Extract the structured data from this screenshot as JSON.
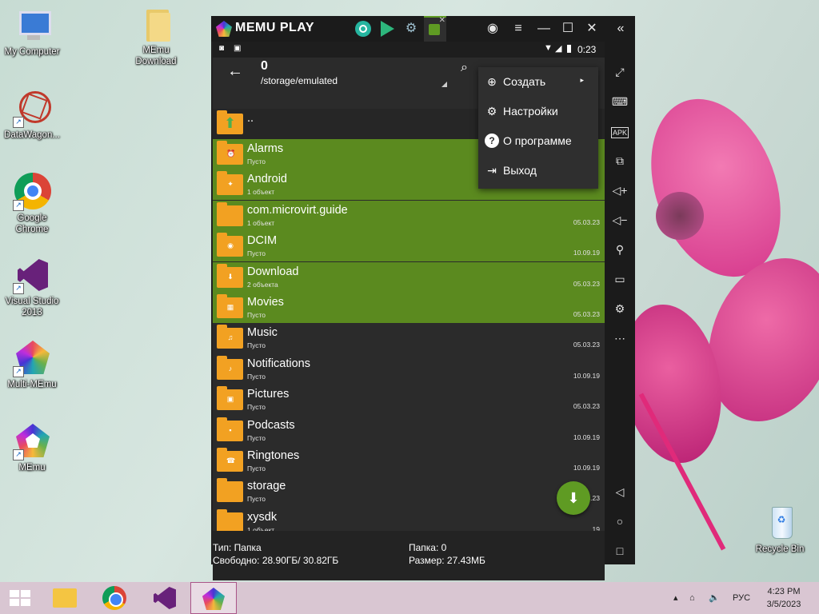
{
  "desktop": {
    "icons": [
      {
        "label": "My Computer",
        "icon": "computer-icon"
      },
      {
        "label": "MEmu Download",
        "icon": "folder-icon"
      },
      {
        "label": "DataWagon...",
        "icon": "datawagon-icon"
      },
      {
        "label": "Google Chrome",
        "icon": "chrome-icon"
      },
      {
        "label": "Visual Studio 2013",
        "icon": "visual-studio-icon"
      },
      {
        "label": "Multi-MEmu",
        "icon": "multi-memu-icon"
      },
      {
        "label": "MEmu",
        "icon": "memu-icon"
      },
      {
        "label": "Recycle Bin",
        "icon": "recycle-bin-icon"
      }
    ]
  },
  "emulator": {
    "title": "MEMU PLAY",
    "tabs": [
      "home",
      "play-store",
      "settings",
      "file-manager"
    ],
    "status": {
      "time": "0:23"
    },
    "appbar": {
      "title": "0",
      "path": "/storage/emulated"
    },
    "parent_row": "..",
    "files": [
      {
        "name": "Alarms",
        "sub": "Пусто",
        "date": "",
        "selected": true,
        "glyph": "⏰"
      },
      {
        "name": "Android",
        "sub": "1 объект",
        "date": "",
        "selected": true,
        "glyph": "✦"
      },
      {
        "name": "com.microvirt.guide",
        "sub": "1 объект",
        "date": "05.03.23",
        "selected": true,
        "glyph": ""
      },
      {
        "name": "DCIM",
        "sub": "Пусто",
        "date": "10.09.19",
        "selected": true,
        "glyph": "◉"
      },
      {
        "name": "Download",
        "sub": "2 объекта",
        "date": "05.03.23",
        "selected": true,
        "glyph": "⬇"
      },
      {
        "name": "Movies",
        "sub": "Пусто",
        "date": "05.03.23",
        "selected": true,
        "glyph": "▦"
      },
      {
        "name": "Music",
        "sub": "Пусто",
        "date": "05.03.23",
        "selected": false,
        "glyph": "♫"
      },
      {
        "name": "Notifications",
        "sub": "Пусто",
        "date": "10.09.19",
        "selected": false,
        "glyph": "♪"
      },
      {
        "name": "Pictures",
        "sub": "Пусто",
        "date": "05.03.23",
        "selected": false,
        "glyph": "▣"
      },
      {
        "name": "Podcasts",
        "sub": "Пусто",
        "date": "10.09.19",
        "selected": false,
        "glyph": "▪"
      },
      {
        "name": "Ringtones",
        "sub": "Пусто",
        "date": "10.09.19",
        "selected": false,
        "glyph": "☎"
      },
      {
        "name": "storage",
        "sub": "Пусто",
        "date": "05.03.23",
        "selected": false,
        "glyph": ""
      },
      {
        "name": "xysdk",
        "sub": "1 объект",
        "date": "19",
        "selected": false,
        "glyph": ""
      }
    ],
    "menu": [
      {
        "label": "Создать",
        "icon": "add-circle-icon"
      },
      {
        "label": "Настройки",
        "icon": "gear-icon"
      },
      {
        "label": "О программе",
        "icon": "help-icon"
      },
      {
        "label": "Выход",
        "icon": "exit-icon"
      }
    ],
    "footer": {
      "type": "Тип: Папка",
      "free": "Свободно: 28.90ГБ/ 30.82ГБ",
      "folder": "Папка: 0",
      "size": "Размер: 27.43МБ"
    },
    "sidebar": [
      "fullscreen-icon",
      "keyboard-icon",
      "apk-icon",
      "add-window-icon",
      "volume-up-icon",
      "volume-down-icon",
      "location-icon",
      "folder-icon",
      "gear-icon",
      "more-icon",
      "back-icon",
      "home-icon",
      "recents-icon"
    ]
  },
  "taskbar": {
    "lang": "РУС",
    "time": "4:23 PM",
    "date": "3/5/2023"
  }
}
